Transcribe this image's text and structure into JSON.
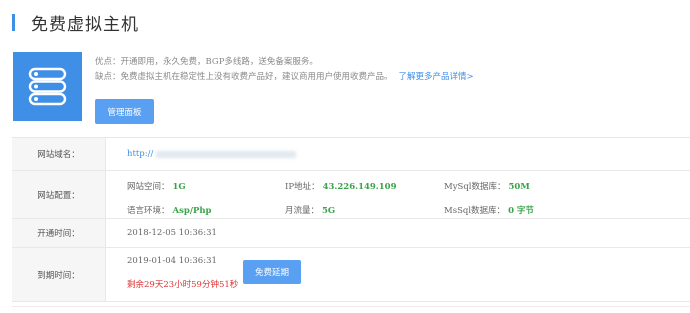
{
  "header": {
    "title": "免费虚拟主机"
  },
  "product": {
    "icon": "server-stack-icon",
    "advantages": "优点：开通即用，永久免费，BGP多线路，送免备案服务。",
    "disadvantages": "缺点：免费虚拟主机在稳定性上没有收费产品好，建议商用用户使用收费产品。",
    "more_link": "了解更多产品详情>",
    "manage_button": "管理面板"
  },
  "table": {
    "domain": {
      "label": "网站域名：",
      "value_prefix": "http://"
    },
    "config": {
      "label": "网站配置：",
      "space_label": "网站空间：",
      "space_value": "1G",
      "ip_label": "IP地址：",
      "ip_value": "43.226.149.109",
      "mysql_label": "MySql数据库：",
      "mysql_value": "50M",
      "lang_label": "语言环境：",
      "lang_value": "Asp/Php",
      "traffic_label": "月流量：",
      "traffic_value": "5G",
      "mssql_label": "MsSql数据库：",
      "mssql_value": "0 字节"
    },
    "open_time": {
      "label": "开通时间：",
      "value": "2018-12-05 10:36:31"
    },
    "expire_time": {
      "label": "到期时间：",
      "value": "2019-01-04 10:36:31",
      "remaining": "剩余29天23小时59分钟51秒",
      "renew_button": "免费延期"
    }
  },
  "colors": {
    "accent": "#3d8fe8",
    "value_green": "#3aa24a",
    "warning_red": "#dd3333"
  }
}
